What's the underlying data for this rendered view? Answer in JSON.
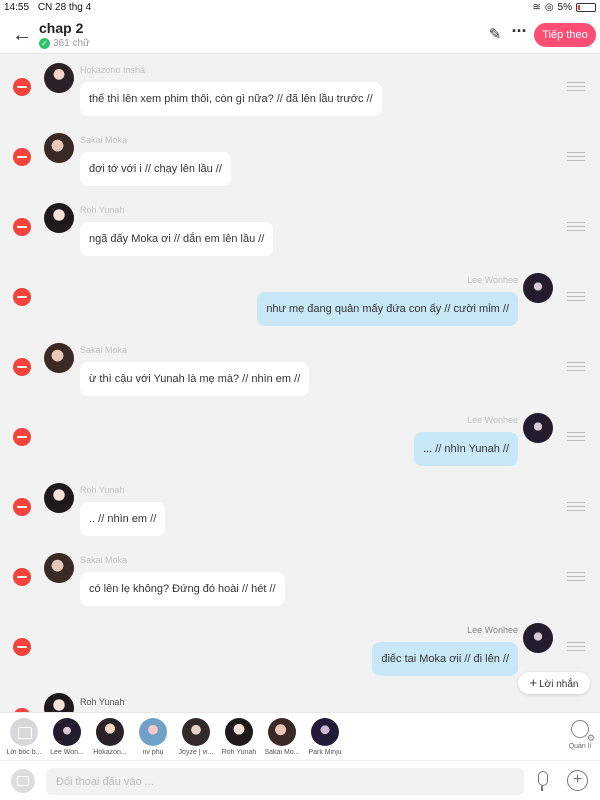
{
  "status_bar": {
    "time": "14:55",
    "date": "CN 28 thg 4",
    "battery": "5%"
  },
  "header": {
    "title": "chap 2",
    "word_count": "361 chữ",
    "next_label": "Tiếp theo"
  },
  "messages": [
    {
      "speaker": "Hokazono Insha",
      "text": "thế thì lên xem phim thôi, còn gì nữa? // đã lên lầu trước //",
      "side": "left"
    },
    {
      "speaker": "Sakai Moka",
      "text": "đợi tớ với i // chạy lên lầu //",
      "side": "left"
    },
    {
      "speaker": "Roh Yunah",
      "text": "ngã đấy Moka ơi // dắn em lên lầu //",
      "side": "left"
    },
    {
      "speaker": "Lee Wonhee",
      "text": "như mẹ đang quản mấy đứa con ấy // cười mỉm //",
      "side": "right"
    },
    {
      "speaker": "Sakai Moka",
      "text": "ừ thì cậu với Yunah là mẹ mà? // nhìn em //",
      "side": "left"
    },
    {
      "speaker": "Lee Wonhee",
      "text": "... // nhìn Yunah //",
      "side": "right"
    },
    {
      "speaker": "Roh Yunah",
      "text": ".. // nhìn em //",
      "side": "left"
    },
    {
      "speaker": "Sakai Moka",
      "text": "có lên lẹ không? Đứng đó hoài // hét //",
      "side": "left"
    },
    {
      "speaker": "Lee Wonhee",
      "text": "điếc tai Moka ơii // đi lên //",
      "side": "right"
    },
    {
      "speaker": "Roh Yunah",
      "text": "",
      "side": "left"
    }
  ],
  "reply_chip": "Lời nhắn",
  "characters": [
    {
      "label": "Lời bốc b...",
      "icon": "narration-icon"
    },
    {
      "label": "Lee Won...",
      "icon": "avatar"
    },
    {
      "label": "Hokazon...",
      "icon": "avatar"
    },
    {
      "label": "nv phụ",
      "icon": "avatar"
    },
    {
      "label": "Joyze | vi...",
      "icon": "avatar"
    },
    {
      "label": "Roh Yunah",
      "icon": "avatar"
    },
    {
      "label": "Sakai Mo...",
      "icon": "avatar"
    },
    {
      "label": "Park Minju",
      "icon": "avatar"
    }
  ],
  "manage_label": "Quản lí",
  "input": {
    "placeholder": "Đối thoại đầu vào ..."
  },
  "colors": {
    "accent": "#ff4e73",
    "right_bubble": "#c8e8f7",
    "delete": "#f4433b"
  }
}
